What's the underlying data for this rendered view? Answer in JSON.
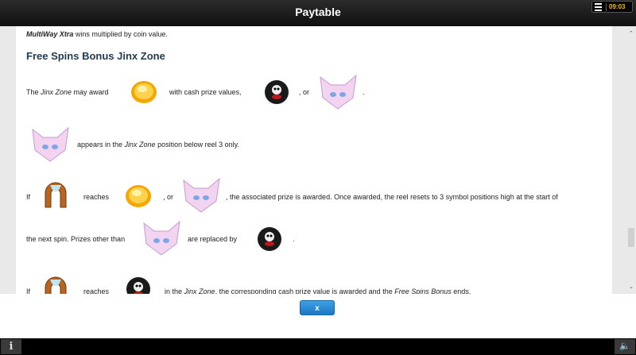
{
  "header": {
    "title": "Paytable",
    "clock": "09:03"
  },
  "content": {
    "intro_bold": "MultiWay Xtra",
    "intro_rest": " wins multiplied by coin value.",
    "section_title": "Free Spins Bonus Jinx Zone",
    "p1_a": "The ",
    "p1_em": "Jinx Zone",
    "p1_b": " may award",
    "p1_c": "with cash prize values,",
    "p1_d": ", or",
    "p1_e": ".",
    "p2_a": "appears in the ",
    "p2_em": "Jinx Zone",
    "p2_b": " position below reel 3 only.",
    "p3_if": "If",
    "p3_reaches": "reaches",
    "p3_or": ", or",
    "p3_rest": ", the associated prize is awarded. Once awarded, the reel resets to 3 symbol positions high at the start of",
    "p4_a": "the next spin. Prizes other than",
    "p4_b": "are replaced by",
    "p4_c": ".",
    "p5_if": "If",
    "p5_reaches": "reaches",
    "p5_a": "in the ",
    "p5_em": "Jinx Zone",
    "p5_b": ", the corresponding cash prize value is awarded and the ",
    "p5_em2": "Free Spins Bonus",
    "p5_c": " ends."
  },
  "footer": {
    "close_label": "x"
  },
  "icons": {
    "coin": "gold-coin-icon",
    "skull": "skull-bomb-icon",
    "cat": "pink-cat-icon",
    "horseshoe": "horseshoe-icon",
    "info": "info-icon",
    "sound": "speaker-icon"
  },
  "colors": {
    "title": "#1f3a52",
    "close_button": "#2a8ad6",
    "clock": "#f0c000"
  }
}
